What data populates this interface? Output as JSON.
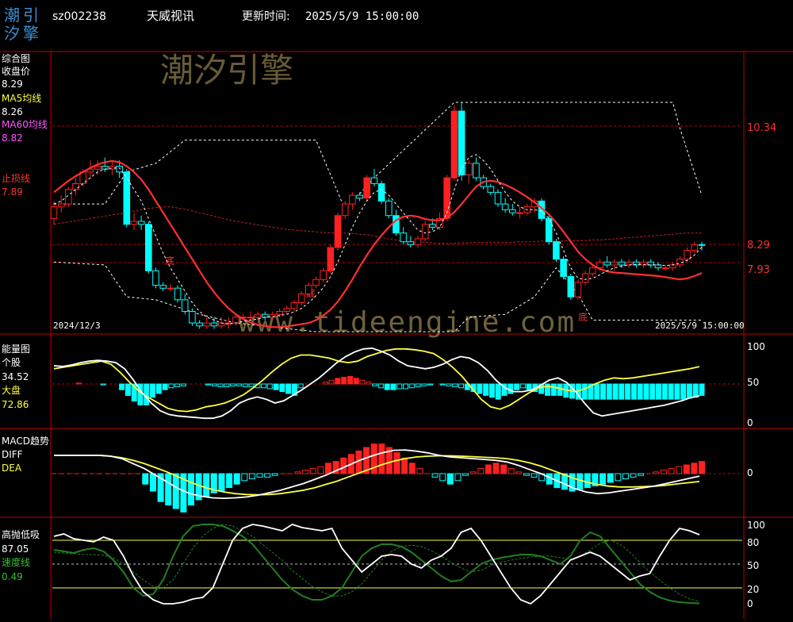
{
  "header": {
    "logo_top": "潮引",
    "logo_bottom": "汐擎",
    "code": "sz002238",
    "name": "天威视讯",
    "update_label": "更新时间:",
    "update_time": "2025/5/9 15:00:00"
  },
  "watermark": {
    "brand": "潮汐引擎",
    "url": "www.tideengine.com"
  },
  "colors": {
    "bg": "#000000",
    "frame": "#c00000",
    "up": "#ff2020",
    "down": "#00ffff",
    "ma5": "#ffffff",
    "ma60": "#ff3030",
    "yellow": "#ffff40",
    "green": "#208020",
    "pink": "#ff55ff",
    "label": "#ffffff"
  },
  "main": {
    "title": "综合图",
    "close_label": "收盘价",
    "close_value": "8.29",
    "ma5_label": "MA5均线",
    "ma5_value": "8.26",
    "ma60_label": "MA60均线",
    "ma60_value": "8.82",
    "stop_label": "止损线",
    "stop_value": "7.89",
    "date_start": "2024/12/3",
    "date_end": "2025/5/9 15:00:00",
    "price_ticks": [
      "10.34",
      "8.29",
      "7.93"
    ],
    "bottom_marks": [
      "底",
      "底",
      "底"
    ]
  },
  "energy": {
    "title": "能量图",
    "stock_label": "个股",
    "stock_value": "34.52",
    "market_label": "大盘",
    "market_value": "72.86",
    "ticks": [
      "100",
      "50",
      "0"
    ]
  },
  "macd": {
    "title": "MACD趋势",
    "diff_label": "DIFF",
    "dea_label": "DEA",
    "ticks": [
      "0"
    ]
  },
  "hl": {
    "title": "高抛低吸",
    "value": "87.05",
    "speed_label": "速度线",
    "speed_value": "0.49",
    "ticks": [
      "100",
      "80",
      "50",
      "20",
      "0"
    ]
  },
  "chart_data": {
    "type": "candlestick",
    "ohlc": [
      [
        8.75,
        9.05,
        8.65,
        8.95
      ],
      [
        8.95,
        9.15,
        8.85,
        9.0
      ],
      [
        9.0,
        9.3,
        8.95,
        9.25
      ],
      [
        9.25,
        9.45,
        9.15,
        9.35
      ],
      [
        9.35,
        9.6,
        9.3,
        9.55
      ],
      [
        9.55,
        9.75,
        9.45,
        9.6
      ],
      [
        9.6,
        9.75,
        9.5,
        9.65
      ],
      [
        9.65,
        9.8,
        9.55,
        9.6
      ],
      [
        9.6,
        9.75,
        9.5,
        9.65
      ],
      [
        9.65,
        9.75,
        9.45,
        9.55
      ],
      [
        9.55,
        9.6,
        8.6,
        8.65
      ],
      [
        8.65,
        8.85,
        8.55,
        8.7
      ],
      [
        8.7,
        8.8,
        8.55,
        8.65
      ],
      [
        8.65,
        8.7,
        7.8,
        7.85
      ],
      [
        7.85,
        7.9,
        7.55,
        7.6
      ],
      [
        7.6,
        7.65,
        7.5,
        7.55
      ],
      [
        7.55,
        7.62,
        7.5,
        7.55
      ],
      [
        7.55,
        7.6,
        7.3,
        7.35
      ],
      [
        7.35,
        7.45,
        7.1,
        7.15
      ],
      [
        7.15,
        7.2,
        6.9,
        6.95
      ],
      [
        6.95,
        7.0,
        6.85,
        6.9
      ],
      [
        6.9,
        7.05,
        6.85,
        6.95
      ],
      [
        6.95,
        7.05,
        6.85,
        6.9
      ],
      [
        6.9,
        7.05,
        6.85,
        6.95
      ],
      [
        6.95,
        7.05,
        6.85,
        6.95
      ],
      [
        6.95,
        7.1,
        6.9,
        7.05
      ],
      [
        7.05,
        7.1,
        7.0,
        7.05
      ],
      [
        7.05,
        7.15,
        7.0,
        7.05
      ],
      [
        7.05,
        7.15,
        7.0,
        7.1
      ],
      [
        7.1,
        7.15,
        7.0,
        7.05
      ],
      [
        7.05,
        7.15,
        7.0,
        7.1
      ],
      [
        7.1,
        7.2,
        7.05,
        7.15
      ],
      [
        7.15,
        7.25,
        7.1,
        7.2
      ],
      [
        7.2,
        7.35,
        7.15,
        7.3
      ],
      [
        7.3,
        7.5,
        7.25,
        7.45
      ],
      [
        7.45,
        7.65,
        7.4,
        7.6
      ],
      [
        7.6,
        7.75,
        7.55,
        7.7
      ],
      [
        7.7,
        7.9,
        7.65,
        7.85
      ],
      [
        7.85,
        8.3,
        7.8,
        8.25
      ],
      [
        8.25,
        8.85,
        8.2,
        8.8
      ],
      [
        8.8,
        9.05,
        8.75,
        9.0
      ],
      [
        9.0,
        9.2,
        8.9,
        9.15
      ],
      [
        9.15,
        9.2,
        9.05,
        9.1
      ],
      [
        9.1,
        9.5,
        9.05,
        9.45
      ],
      [
        9.45,
        9.6,
        9.3,
        9.35
      ],
      [
        9.35,
        9.4,
        9.0,
        9.05
      ],
      [
        9.05,
        9.1,
        8.75,
        8.8
      ],
      [
        8.8,
        8.9,
        8.45,
        8.5
      ],
      [
        8.5,
        8.6,
        8.3,
        8.35
      ],
      [
        8.35,
        8.45,
        8.25,
        8.3
      ],
      [
        8.3,
        8.45,
        8.25,
        8.4
      ],
      [
        8.4,
        8.7,
        8.35,
        8.65
      ],
      [
        8.65,
        8.75,
        8.55,
        8.6
      ],
      [
        8.6,
        8.85,
        8.55,
        8.75
      ],
      [
        8.75,
        9.5,
        8.7,
        9.45
      ],
      [
        9.45,
        10.7,
        9.4,
        10.6
      ],
      [
        10.6,
        10.75,
        9.4,
        9.5
      ],
      [
        9.5,
        9.75,
        9.35,
        9.7
      ],
      [
        9.7,
        9.8,
        9.4,
        9.45
      ],
      [
        9.45,
        9.5,
        9.25,
        9.3
      ],
      [
        9.3,
        9.35,
        9.15,
        9.2
      ],
      [
        9.2,
        9.25,
        8.95,
        9.0
      ],
      [
        9.0,
        9.1,
        8.85,
        8.9
      ],
      [
        8.9,
        9.0,
        8.8,
        8.85
      ],
      [
        8.85,
        8.95,
        8.75,
        8.85
      ],
      [
        8.85,
        9.0,
        8.8,
        8.95
      ],
      [
        8.95,
        9.1,
        8.85,
        9.05
      ],
      [
        9.05,
        9.1,
        8.7,
        8.75
      ],
      [
        8.75,
        8.8,
        8.3,
        8.35
      ],
      [
        8.35,
        8.4,
        8.0,
        8.05
      ],
      [
        8.05,
        8.1,
        7.7,
        7.75
      ],
      [
        7.75,
        7.8,
        7.35,
        7.4
      ],
      [
        7.4,
        7.7,
        7.35,
        7.65
      ],
      [
        7.65,
        7.85,
        7.6,
        7.8
      ],
      [
        7.8,
        7.95,
        7.75,
        7.9
      ],
      [
        7.9,
        8.05,
        7.85,
        8.0
      ],
      [
        8.0,
        8.1,
        7.9,
        7.95
      ],
      [
        7.95,
        8.05,
        7.85,
        8.0
      ],
      [
        8.0,
        8.05,
        7.9,
        7.95
      ],
      [
        7.95,
        8.05,
        7.9,
        8.0
      ],
      [
        8.0,
        8.05,
        7.9,
        7.95
      ],
      [
        7.95,
        8.05,
        7.9,
        8.0
      ],
      [
        8.0,
        8.05,
        7.9,
        7.95
      ],
      [
        7.95,
        8.0,
        7.85,
        7.9
      ],
      [
        7.9,
        7.95,
        7.85,
        7.9
      ],
      [
        7.9,
        8.0,
        7.85,
        7.95
      ],
      [
        7.95,
        8.1,
        7.9,
        8.05
      ],
      [
        8.05,
        8.25,
        8.0,
        8.2
      ],
      [
        8.2,
        8.35,
        8.15,
        8.3
      ],
      [
        8.3,
        8.35,
        8.2,
        8.29
      ]
    ],
    "ma60": [
      8.65,
      8.67,
      8.69,
      8.71,
      8.73,
      8.75,
      8.77,
      8.79,
      8.81,
      8.83,
      8.85,
      8.88,
      8.9,
      8.92,
      8.94,
      8.95,
      8.95,
      8.93,
      8.91,
      8.88,
      8.85,
      8.82,
      8.79,
      8.76,
      8.73,
      8.7,
      8.68,
      8.66,
      8.64,
      8.62,
      8.6,
      8.58,
      8.56,
      8.55,
      8.54,
      8.53,
      8.52,
      8.51,
      8.5,
      8.5,
      8.5,
      8.49,
      8.48,
      8.47,
      8.45,
      8.42,
      8.4,
      8.38,
      8.36,
      8.35,
      8.35,
      8.34,
      8.33,
      8.32,
      8.32,
      8.32,
      8.33,
      8.33,
      8.34,
      8.34,
      8.34,
      8.34,
      8.34,
      8.34,
      8.35,
      8.35,
      8.35,
      8.36,
      8.36,
      8.36,
      8.36,
      8.37,
      8.37,
      8.37,
      8.38,
      8.38,
      8.39,
      8.4,
      8.41,
      8.42,
      8.43,
      8.44,
      8.45,
      8.46,
      8.47,
      8.48,
      8.49,
      8.5,
      8.5,
      8.5
    ],
    "ma_red": [
      9.2,
      9.3,
      9.4,
      9.48,
      9.55,
      9.62,
      9.68,
      9.72,
      9.74,
      9.72,
      9.65,
      9.55,
      9.42,
      9.25,
      9.05,
      8.85,
      8.65,
      8.45,
      8.25,
      8.05,
      7.85,
      7.65,
      7.48,
      7.33,
      7.2,
      7.1,
      7.02,
      6.96,
      6.92,
      6.9,
      6.88,
      6.88,
      6.89,
      6.91,
      6.93,
      6.95,
      7.0,
      7.08,
      7.18,
      7.32,
      7.5,
      7.7,
      7.92,
      8.12,
      8.3,
      8.46,
      8.6,
      8.72,
      8.78,
      8.8,
      8.78,
      8.74,
      8.72,
      8.72,
      8.76,
      8.86,
      9.0,
      9.15,
      9.3,
      9.38,
      9.4,
      9.38,
      9.33,
      9.27,
      9.2,
      9.12,
      9.03,
      8.93,
      8.82,
      8.68,
      8.52,
      8.35,
      8.18,
      8.05,
      7.95,
      7.88,
      7.84,
      7.82,
      7.81,
      7.8,
      7.79,
      7.78,
      7.77,
      7.76,
      7.74,
      7.72,
      7.7,
      7.72,
      7.76,
      7.81
    ],
    "ma5_overlay": [
      9.0,
      9.05,
      9.15,
      9.25,
      9.35,
      9.45,
      9.55,
      9.6,
      9.62,
      9.62,
      9.45,
      9.25,
      9.05,
      8.75,
      8.45,
      8.15,
      7.9,
      7.7,
      7.5,
      7.3,
      7.15,
      7.05,
      7.0,
      6.95,
      6.93,
      6.95,
      6.98,
      7.0,
      7.02,
      7.05,
      7.06,
      7.08,
      7.1,
      7.14,
      7.2,
      7.3,
      7.42,
      7.56,
      7.75,
      8.0,
      8.3,
      8.6,
      8.85,
      9.05,
      9.2,
      9.25,
      9.15,
      9.0,
      8.85,
      8.7,
      8.55,
      8.5,
      8.52,
      8.6,
      8.85,
      9.25,
      9.6,
      9.8,
      9.85,
      9.75,
      9.6,
      9.4,
      9.2,
      9.05,
      8.95,
      8.9,
      8.9,
      8.88,
      8.75,
      8.5,
      8.2,
      7.9,
      7.72,
      7.7,
      7.72,
      7.78,
      7.85,
      7.9,
      7.93,
      7.95,
      7.96,
      7.96,
      7.95,
      7.95,
      7.94,
      7.95,
      7.98,
      8.03,
      8.12,
      8.26
    ],
    "upper_band_steps": [
      [
        0,
        9.0
      ],
      [
        7,
        9.0
      ],
      [
        10,
        9.55
      ],
      [
        14,
        9.7
      ],
      [
        18,
        10.1
      ],
      [
        36,
        10.1
      ],
      [
        40,
        8.9
      ],
      [
        44,
        9.45
      ],
      [
        55,
        10.75
      ],
      [
        85,
        10.75
      ],
      [
        86,
        10.3
      ],
      [
        89,
        9.15
      ]
    ],
    "lower_band_steps": [
      [
        0,
        8.0
      ],
      [
        7,
        7.95
      ],
      [
        10,
        7.4
      ],
      [
        14,
        7.35
      ],
      [
        20,
        7.1
      ],
      [
        25,
        6.95
      ],
      [
        36,
        6.8
      ],
      [
        55,
        6.8
      ],
      [
        57,
        7.05
      ],
      [
        62,
        7.1
      ],
      [
        66,
        7.4
      ],
      [
        69,
        7.9
      ],
      [
        71,
        7.6
      ],
      [
        72,
        7.45
      ],
      [
        74,
        7.0
      ],
      [
        89,
        7.0
      ]
    ],
    "energy_stock": [
      74,
      73,
      75,
      78,
      80,
      81,
      80,
      78,
      70,
      55,
      38,
      25,
      15,
      10,
      8,
      7,
      6,
      5,
      5,
      8,
      15,
      25,
      30,
      33,
      30,
      25,
      28,
      35,
      42,
      50,
      58,
      68,
      78,
      86,
      92,
      96,
      97,
      93,
      88,
      80,
      74,
      72,
      70,
      72,
      76,
      82,
      86,
      84,
      78,
      68,
      55,
      45,
      40,
      40,
      42,
      48,
      55,
      58,
      52,
      40,
      25,
      12,
      8,
      10,
      12,
      14,
      16,
      18,
      20,
      22,
      25,
      28,
      32,
      34.52
    ],
    "energy_market": [
      70,
      72,
      74,
      76,
      78,
      80,
      76,
      65,
      52,
      40,
      32,
      25,
      18,
      15,
      14,
      16,
      20,
      22,
      25,
      30,
      36,
      45,
      55,
      66,
      76,
      84,
      88,
      88,
      86,
      84,
      80,
      78,
      80,
      86,
      90,
      94,
      96,
      96,
      95,
      93,
      90,
      82,
      72,
      60,
      45,
      30,
      20,
      17,
      22,
      30,
      38,
      45,
      47,
      45,
      42,
      40,
      44,
      50,
      55,
      58,
      57,
      58,
      60,
      62,
      64,
      66,
      68,
      70,
      72.86
    ],
    "energy_hist": [
      0,
      0,
      0,
      0,
      1,
      0,
      0,
      0,
      -1,
      0,
      0,
      -6,
      -12,
      -18,
      -22,
      -22,
      -14,
      -10,
      -6,
      -4,
      -3,
      -2,
      0,
      0,
      0,
      -1,
      -2,
      -3,
      -3,
      -2,
      -2,
      -3,
      -3,
      -4,
      -4,
      -5,
      -6,
      -8,
      -10,
      -12,
      -4,
      0,
      0,
      0,
      2,
      4,
      6,
      7,
      8,
      6,
      4,
      2,
      -2,
      -4,
      -6,
      -6,
      -5,
      -5,
      -4,
      -3,
      -2,
      -1,
      0,
      -1,
      -2,
      -3,
      -4,
      -6,
      -8,
      -10,
      -12,
      -14,
      -16,
      -12,
      -10,
      -6,
      -4,
      -6,
      -8,
      -10,
      -12,
      -12,
      -12,
      -14,
      -15,
      -16,
      -16,
      -16,
      -16,
      -16,
      -16,
      -16,
      -16,
      -16,
      -16,
      -16,
      -16,
      -16,
      -16,
      -16,
      -16,
      -16,
      -16,
      -15,
      -14,
      -12
    ],
    "macd_hist": [
      0,
      0,
      0,
      0,
      0,
      0,
      0,
      0,
      0,
      0,
      0,
      0,
      -6,
      -10,
      -16,
      -18,
      -20,
      -22,
      -18,
      -15,
      -13,
      -11,
      -10,
      -8,
      -6,
      -4,
      -3,
      -2,
      -2,
      -1,
      0,
      0,
      1,
      2,
      3,
      4,
      6,
      7,
      9,
      11,
      13,
      15,
      17,
      17,
      15,
      12,
      9,
      6,
      3,
      0,
      -2,
      -4,
      -6,
      -4,
      -1,
      1,
      3,
      5,
      6,
      5,
      3,
      1,
      -1,
      -2,
      -4,
      -6,
      -8,
      -9,
      -10,
      -9,
      -8,
      -7,
      -6,
      -5,
      -4,
      -3,
      -2,
      -1,
      0,
      1,
      2,
      3,
      4,
      5,
      6,
      7
    ],
    "macd_diff": [
      1.1,
      1.1,
      1.1,
      1.1,
      1.1,
      1.05,
      0.9,
      0.6,
      0.3,
      -0.1,
      -0.5,
      -0.9,
      -1.2,
      -1.35,
      -1.45,
      -1.48,
      -1.45,
      -1.4,
      -1.3,
      -1.15,
      -1.0,
      -0.8,
      -0.6,
      -0.35,
      -0.1,
      0.2,
      0.5,
      0.8,
      1.05,
      1.25,
      1.4,
      1.42,
      1.35,
      1.25,
      1.1,
      1.0,
      0.95,
      0.9,
      0.85,
      0.8,
      0.7,
      0.5,
      0.25,
      0.0,
      -0.3,
      -0.6,
      -0.9,
      -1.1,
      -1.2,
      -1.15,
      -1.05,
      -0.95,
      -0.85,
      -0.75,
      -0.6,
      -0.45,
      -0.3,
      -0.15
    ],
    "macd_dea": [
      1.1,
      1.1,
      1.1,
      1.1,
      1.1,
      1.05,
      0.95,
      0.8,
      0.6,
      0.35,
      0.1,
      -0.2,
      -0.5,
      -0.75,
      -0.95,
      -1.1,
      -1.2,
      -1.25,
      -1.27,
      -1.25,
      -1.2,
      -1.1,
      -1.0,
      -0.85,
      -0.65,
      -0.45,
      -0.2,
      0.05,
      0.3,
      0.55,
      0.75,
      0.9,
      1.0,
      1.05,
      1.07,
      1.07,
      1.05,
      1.02,
      0.98,
      0.95,
      0.9,
      0.8,
      0.65,
      0.45,
      0.2,
      -0.05,
      -0.3,
      -0.5,
      -0.65,
      -0.75,
      -0.8,
      -0.8,
      -0.78,
      -0.75,
      -0.7,
      -0.62,
      -0.55,
      -0.47
    ],
    "hl_white": [
      85,
      88,
      82,
      80,
      78,
      84,
      80,
      60,
      35,
      15,
      5,
      0,
      0,
      2,
      6,
      8,
      20,
      50,
      80,
      95,
      100,
      98,
      95,
      92,
      100,
      96,
      94,
      92,
      95,
      70,
      55,
      40,
      50,
      60,
      62,
      60,
      50,
      45,
      55,
      60,
      70,
      90,
      95,
      80,
      60,
      40,
      20,
      5,
      0,
      10,
      25,
      40,
      55,
      60,
      65,
      60,
      50,
      40,
      30,
      35,
      38,
      60,
      80,
      95,
      92,
      87.05
    ],
    "hl_green": [
      68,
      66,
      64,
      68,
      70,
      66,
      55,
      40,
      20,
      10,
      12,
      30,
      60,
      85,
      98,
      100,
      100,
      98,
      92,
      85,
      75,
      60,
      45,
      30,
      18,
      10,
      5,
      5,
      10,
      20,
      40,
      60,
      70,
      75,
      75,
      72,
      65,
      55,
      45,
      35,
      28,
      30,
      40,
      50,
      55,
      58,
      60,
      62,
      62,
      60,
      55,
      50,
      60,
      80,
      90,
      85,
      70,
      55,
      40,
      25,
      15,
      8,
      4,
      2,
      1,
      0.49
    ],
    "hl_green_dash": [
      65,
      64,
      63,
      62,
      62,
      61,
      58,
      50,
      40,
      30,
      22,
      20,
      30,
      50,
      70,
      85,
      95,
      100,
      98,
      92,
      85,
      75,
      65,
      55,
      42,
      32,
      22,
      15,
      10,
      10,
      15,
      25,
      40,
      55,
      66,
      72,
      74,
      72,
      67,
      60,
      52,
      45,
      40,
      42,
      48,
      52,
      55,
      57,
      59,
      60,
      60,
      58,
      56,
      60,
      68,
      76,
      80,
      75,
      65,
      52,
      40,
      30,
      20,
      12,
      6,
      3
    ]
  }
}
